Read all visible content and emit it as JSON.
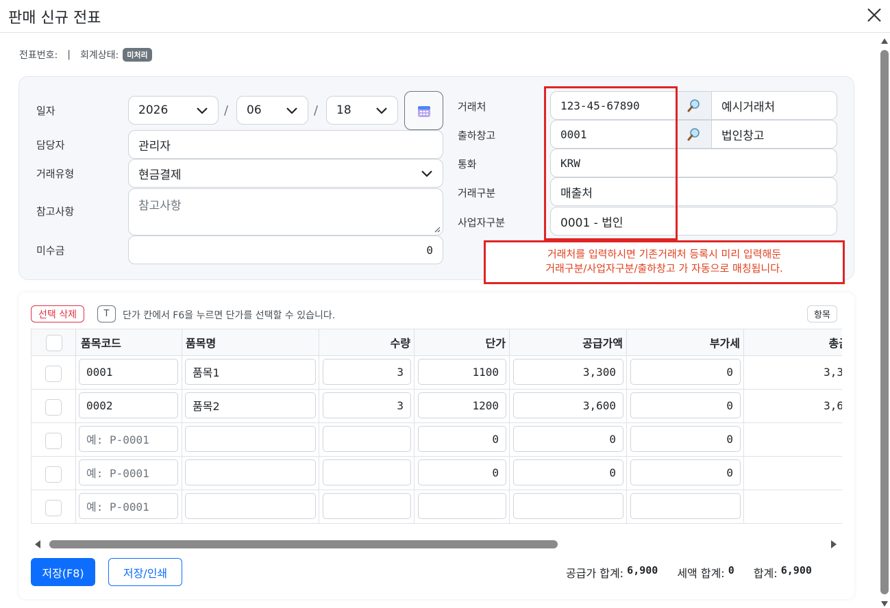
{
  "dialog": {
    "title": "판매 신규 전표"
  },
  "meta": {
    "slip_no_label": "전표번호:",
    "separator": "|",
    "accounting_status_label": "회계상태:",
    "accounting_status_badge": "미처리"
  },
  "form": {
    "date_label": "일자",
    "year": "2026",
    "month": "06",
    "day": "18",
    "date_sep": "/",
    "manager_label": "담당자",
    "manager": "관리자",
    "trade_type_label": "거래유형",
    "trade_type": "현금결제",
    "memo_label": "참고사항",
    "memo_placeholder": "참고사항",
    "receivable_label": "미수금",
    "receivable": "0",
    "client_label": "거래처",
    "client_code": "123-45-67890",
    "client_name": "예시거래처",
    "warehouse_label": "출하창고",
    "warehouse_code": "0001",
    "warehouse_name": "법인창고",
    "currency_label": "통화",
    "currency": "KRW",
    "trade_class_label": "거래구분",
    "trade_class": "매출처",
    "biz_class_label": "사업자구분",
    "biz_class": "0001 - 법인"
  },
  "notice": {
    "line1": "거래처를 입력하시면 기존거래처 등록시 미리 입력해둔",
    "line2": "거래구분/사업자구분/출하창고 가 자동으로 매칭됩니다."
  },
  "toolbar": {
    "delete_selected": "선택 삭제",
    "shortcut_key": "T",
    "hint": "단가 칸에서 F6을 누르면 단가를 선택할 수 있습니다.",
    "columns_button": "항목"
  },
  "table": {
    "headers": [
      "품목코드",
      "품목명",
      "수량",
      "단가",
      "공급가액",
      "부가세",
      "총금"
    ],
    "code_placeholder": "예: P-0001",
    "rows": [
      {
        "code": "0001",
        "name": "품목1",
        "qty": "3",
        "price": "1100",
        "supply": "3,300",
        "vat": "0",
        "total": "3,3"
      },
      {
        "code": "0002",
        "name": "품목2",
        "qty": "3",
        "price": "1200",
        "supply": "3,600",
        "vat": "0",
        "total": "3,6"
      },
      {
        "code": "",
        "name": "",
        "qty": "",
        "price": "0",
        "supply": "0",
        "vat": "0",
        "total": ""
      },
      {
        "code": "",
        "name": "",
        "qty": "",
        "price": "0",
        "supply": "0",
        "vat": "0",
        "total": ""
      },
      {
        "code": "",
        "name": "",
        "qty": "",
        "price": "",
        "supply": "",
        "vat": "",
        "total": ""
      }
    ]
  },
  "footer": {
    "save": "저장(F8)",
    "save_print": "저장/인쇄",
    "supply_total_label": "공급가 합계:",
    "supply_total": "6,900",
    "tax_total_label": "세액 합계:",
    "tax_total": "0",
    "grand_total_label": "합계:",
    "grand_total": "6,900"
  }
}
